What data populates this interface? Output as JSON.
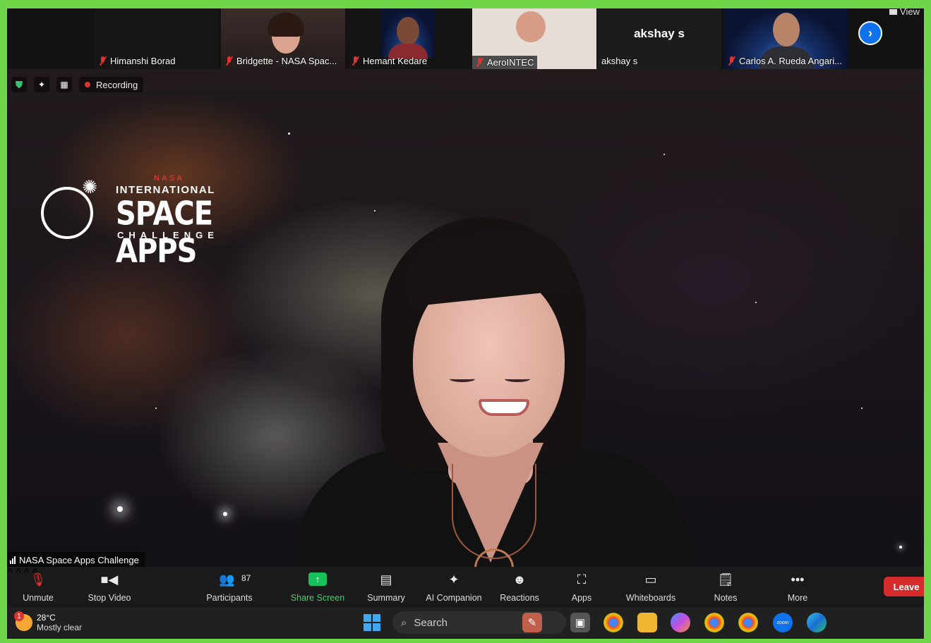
{
  "gallery": {
    "tiles": [
      {
        "name": "Himanshi Borad",
        "muted": true
      },
      {
        "name": "Bridgette - NASA Spac...",
        "muted": true
      },
      {
        "name": "Hemant Kedare",
        "muted": true
      },
      {
        "name": "AeroINTEC",
        "muted": true
      },
      {
        "name": "akshay s",
        "display_name": "akshay s",
        "muted": false
      },
      {
        "name": "Carlos A. Rueda Angari...",
        "muted": true
      }
    ],
    "view_label": "View",
    "next_icon": "chevron-right-icon"
  },
  "meeting": {
    "recording_label": "Recording",
    "speaker_label": "NASA Space Apps Challenge",
    "logo": {
      "nasa": "NASA",
      "line1": "INTERNATIONAL",
      "line2": "SPACE APPS",
      "line3": "CHALLENGE"
    }
  },
  "toolbar": {
    "unmute": "Unmute",
    "stop_video": "Stop Video",
    "participants": "Participants",
    "participants_count": "87",
    "share_screen": "Share Screen",
    "summary": "Summary",
    "ai_companion": "AI Companion",
    "reactions": "Reactions",
    "apps": "Apps",
    "whiteboards": "Whiteboards",
    "notes": "Notes",
    "more": "More",
    "leave": "Leave"
  },
  "taskbar": {
    "temperature": "28°C",
    "condition": "Mostly clear",
    "notification_count": "1",
    "search_placeholder": "Search"
  },
  "colors": {
    "border": "#6fd64a",
    "share_green": "#17c05a",
    "leave_red": "#d52b2b",
    "accent_blue": "#0e72ed"
  }
}
